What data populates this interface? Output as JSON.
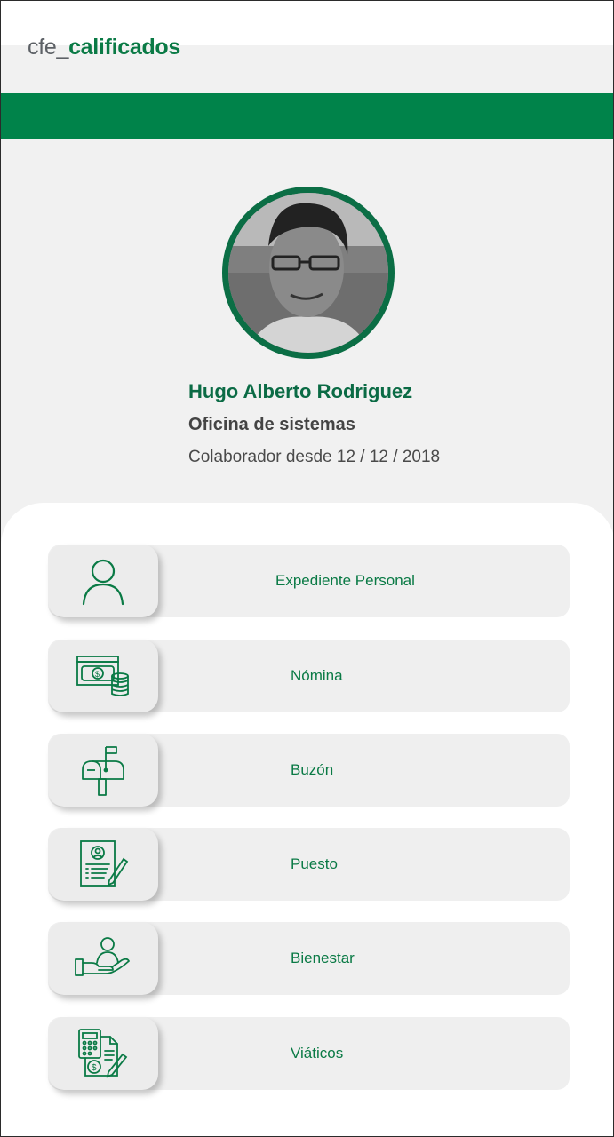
{
  "app": {
    "logo_prefix": "cfe_",
    "logo_brand": "calificados"
  },
  "profile": {
    "name": "Hugo Alberto Rodriguez",
    "department": "Oficina de sistemas",
    "since": "Colaborador desde 12 / 12 / 2018"
  },
  "menu": [
    {
      "label": "Expediente Personal",
      "icon": "person-icon"
    },
    {
      "label": "Nómina",
      "icon": "payroll-money-icon"
    },
    {
      "label": "Buzón",
      "icon": "mailbox-icon"
    },
    {
      "label": "Puesto",
      "icon": "job-document-icon"
    },
    {
      "label": "Bienestar",
      "icon": "wellbeing-hand-icon"
    },
    {
      "label": "Viáticos",
      "icon": "travel-expenses-icon"
    }
  ],
  "colors": {
    "brand_green": "#00834a",
    "text_green": "#0a7a45",
    "background": "#f1f1f1"
  }
}
